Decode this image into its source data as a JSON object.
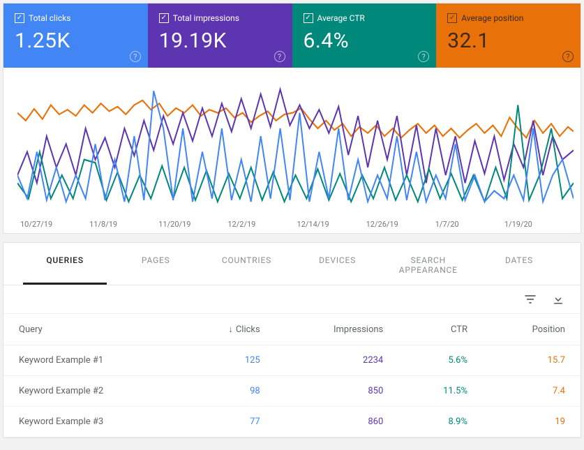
{
  "metrics": {
    "clicks": {
      "label": "Total clicks",
      "value": "1.25K",
      "color": "#4285f4"
    },
    "impressions": {
      "label": "Total impressions",
      "value": "19.19K",
      "color": "#5e35b1"
    },
    "ctr": {
      "label": "Average CTR",
      "value": "6.4%",
      "color": "#00897b"
    },
    "position": {
      "label": "Average position",
      "value": "32.1",
      "color": "#e8710a"
    }
  },
  "chart_data": {
    "type": "line",
    "xlabel": "",
    "ylabel": "",
    "x_ticks": [
      "10/27/19",
      "11/8/19",
      "11/20/19",
      "12/2/19",
      "12/14/19",
      "12/26/19",
      "1/7/20",
      "1/19/20"
    ],
    "note": "per-day values not labeled on source; series colors map to metric tiles (clicks=blue, impressions=purple, ctr=teal, position=orange)",
    "series": [
      {
        "name": "Total clicks",
        "color": "#4285f4"
      },
      {
        "name": "Total impressions",
        "color": "#5e35b1"
      },
      {
        "name": "Average CTR",
        "color": "#00897b"
      },
      {
        "name": "Average position",
        "color": "#e8710a"
      }
    ]
  },
  "tabs": [
    "QUERIES",
    "PAGES",
    "COUNTRIES",
    "DEVICES",
    "SEARCH APPEARANCE",
    "DATES"
  ],
  "active_tab": 0,
  "table": {
    "headers": {
      "query": "Query",
      "clicks": "Clicks",
      "impressions": "Impressions",
      "ctr": "CTR",
      "position": "Position"
    },
    "sort_indicator": "↓",
    "rows": [
      {
        "query": "Keyword Example #1",
        "clicks": "125",
        "impressions": "2234",
        "ctr": "5.6%",
        "position": "15.7"
      },
      {
        "query": "Keyword Example #2",
        "clicks": "98",
        "impressions": "850",
        "ctr": "11.5%",
        "position": "7.4"
      },
      {
        "query": "Keyword Example #3",
        "clicks": "77",
        "impressions": "860",
        "ctr": "8.9%",
        "position": "19"
      }
    ]
  },
  "icons": {
    "check": "✓",
    "help": "?",
    "filter": "filter-icon",
    "download": "download-icon"
  }
}
